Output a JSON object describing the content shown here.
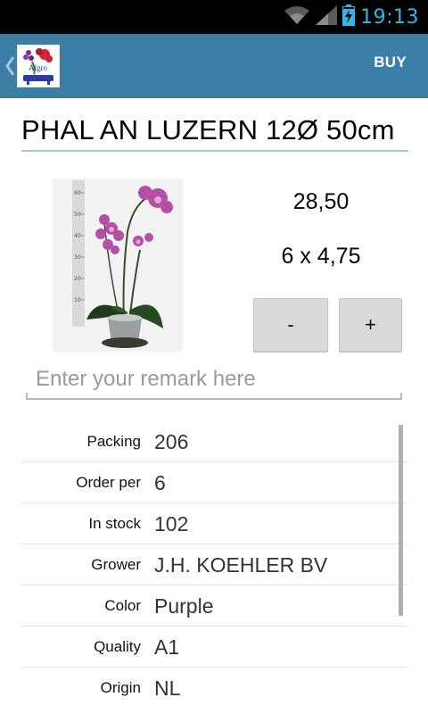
{
  "status_bar": {
    "time": "19:13",
    "icons": [
      "wifi-icon",
      "signal-icon",
      "battery-charging-icon"
    ],
    "time_color": "#33b5e5"
  },
  "action_bar": {
    "background": "#3d7ea6",
    "logo_text": "Algro",
    "buy_label": "BUY"
  },
  "product": {
    "title": "PHAL AN LUZERN 12Ø 50cm",
    "price": "28,50",
    "pack_price": "6 x 4,75",
    "photo_ruler_labels": [
      "60",
      "50",
      "40",
      "30",
      "20",
      "10"
    ]
  },
  "quantity": {
    "minus_label": "-",
    "plus_label": "+"
  },
  "remark": {
    "placeholder": "Enter your remark here",
    "value": ""
  },
  "details": [
    {
      "label": "Packing",
      "value": "206"
    },
    {
      "label": "Order per",
      "value": "6"
    },
    {
      "label": "In stock",
      "value": "102"
    },
    {
      "label": "Grower",
      "value": "J.H. KOEHLER BV"
    },
    {
      "label": "Color",
      "value": "Purple"
    },
    {
      "label": "Quality",
      "value": "A1"
    },
    {
      "label": "Origin",
      "value": "NL"
    }
  ]
}
